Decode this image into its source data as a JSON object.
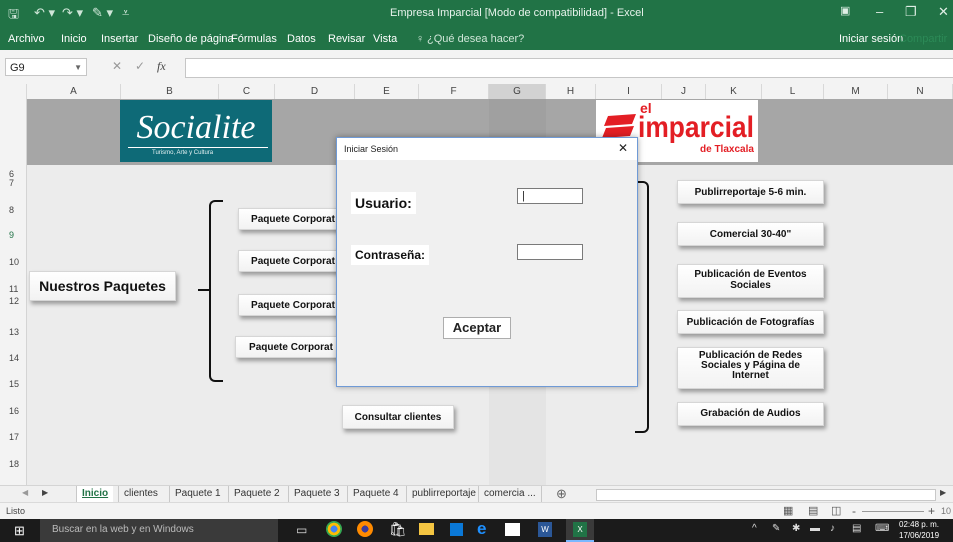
{
  "window": {
    "title": "Empresa Imparcial  [Modo de compatibilidad] - Excel",
    "minimize": "–",
    "maximize": "❐",
    "close": "✕",
    "ribbon_display": "▣"
  },
  "ribbon": {
    "tabs": [
      "Archivo",
      "Inicio",
      "Insertar",
      "Diseño de página",
      "Fórmulas",
      "Datos",
      "Revisar",
      "Vista"
    ],
    "tell_me": "¿Qué desea hacer?",
    "signin": "Iniciar sesión",
    "share": "Compartir"
  },
  "formula_bar": {
    "name_box": "G9",
    "fx": "fx",
    "value": ""
  },
  "columns": [
    "A",
    "B",
    "C",
    "D",
    "E",
    "F",
    "G",
    "H",
    "I",
    "J",
    "K",
    "L",
    "M",
    "N"
  ],
  "rows": [
    "6",
    "7",
    "8",
    "9",
    "10",
    "11",
    "12",
    "13",
    "14",
    "15",
    "16",
    "17",
    "18"
  ],
  "logos": {
    "left_text": "Socialite",
    "left_sub": "Turismo, Arte y Cultura",
    "right_top": "el",
    "right_main": "imparcial",
    "right_sub": "de Tlaxcala"
  },
  "sheet": {
    "nuestros": "Nuestros Paquetes",
    "paquetes": [
      "Paquete Corporat",
      "Paquete Corporat",
      "Paquete Corporat",
      "Paquete Corporat"
    ],
    "consultar": "Consultar clientes",
    "services": [
      "Publirreportaje 5-6 min.",
      "Comercial 30-40\"",
      "Publicación de Eventos Sociales",
      "Publicación de Fotografías",
      "Publicación de Redes Sociales y Página de Internet",
      "Grabación de Audios"
    ]
  },
  "dialog": {
    "title": "Iniciar Sesión",
    "close": "✕",
    "usuario_label": "Usuario:",
    "usuario_value": "",
    "contrasena_label": "Contraseña:",
    "contrasena_value": "",
    "accept": "Aceptar"
  },
  "sheet_tabs": [
    "Inicio",
    "clientes",
    "Paquete 1",
    "Paquete 2",
    "Paquete 3",
    "Paquete 4",
    "publirreportaje",
    "comercia ..."
  ],
  "status": {
    "ready": "Listo",
    "zoom_out": "-",
    "zoom_in": "+",
    "zoom": "10"
  },
  "taskbar": {
    "search": "Buscar en la web y en Windows",
    "time": "02:48 p. m.",
    "date": "17/06/2019"
  }
}
